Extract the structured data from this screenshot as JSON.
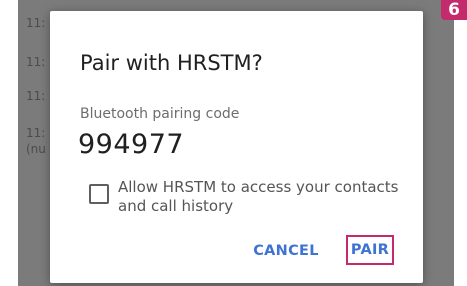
{
  "background": {
    "lines": [
      "11:",
      "11:",
      "11:",
      "11:",
      "(nu"
    ]
  },
  "badge": {
    "text": "6",
    "color": "#c42b6c"
  },
  "dialog": {
    "title": "Pair with HRSTM?",
    "code_label": "Bluetooth pairing code",
    "code_value": "994977",
    "checkbox": {
      "checked": false,
      "label": "Allow HRSTM to access your contacts and call history"
    },
    "buttons": {
      "cancel": "CANCEL",
      "pair": "PAIR"
    },
    "accent_color": "#3f73d3"
  }
}
